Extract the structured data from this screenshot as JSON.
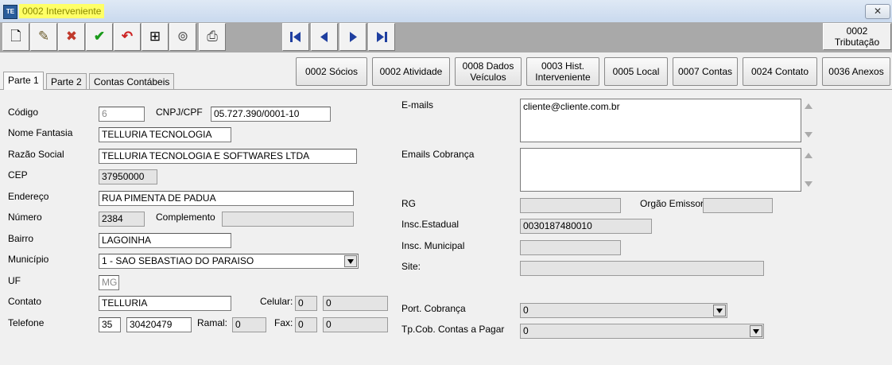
{
  "window": {
    "title": "0002 Interveniente",
    "app_icon": "TE",
    "close_symbol": "✕"
  },
  "toolbar": {
    "icons": [
      "new-document-icon",
      "edit-icon",
      "cancel-icon",
      "confirm-check-icon",
      "undo-icon",
      "binoculars-search-icon",
      "lookup-icon",
      "print-icon"
    ],
    "glyphs": {
      "new": "🗋",
      "edit": "✎",
      "cancel": "✖",
      "confirm": "✔",
      "undo": "↶",
      "search": "⊞",
      "lookup": "⊚",
      "print": "⎙"
    },
    "tributacao_line1": "0002",
    "tributacao_line2": "Tributação"
  },
  "actions": {
    "socios": "0002 Sócios",
    "atividade": "0002 Atividade",
    "dados_veiculos_1": "0008 Dados",
    "dados_veiculos_2": "Veículos",
    "hist_1": "0003 Hist.",
    "hist_2": "Interveniente",
    "local": "0005 Local",
    "contas": "0007 Contas",
    "contato": "0024 Contato",
    "anexos": "0036 Anexos"
  },
  "tabs": [
    "Parte 1",
    "Parte 2",
    "Contas Contábeis"
  ],
  "form_left": {
    "codigo_label": "Código",
    "codigo_value": "6",
    "cnpj_label": "CNPJ/CPF",
    "cnpj_value": "05.727.390/0001-10",
    "nome_fantasia_label": "Nome Fantasia",
    "nome_fantasia_value": "TELLURIA TECNOLOGIA",
    "razao_social_label": "Razão Social",
    "razao_social_value": "TELLURIA TECNOLOGIA E SOFTWARES LTDA",
    "cep_label": "CEP",
    "cep_value": "37950000",
    "endereco_label": "Endereço",
    "endereco_value": "RUA PIMENTA DE PADUA",
    "numero_label": "Número",
    "numero_value": "2384",
    "complemento_label": "Complemento",
    "complemento_value": "",
    "bairro_label": "Bairro",
    "bairro_value": "LAGOINHA",
    "municipio_label": "Município",
    "municipio_value": "1 - SAO SEBASTIAO DO PARAISO",
    "uf_label": "UF",
    "uf_value": "MG",
    "contato_label": "Contato",
    "contato_value": "TELLURIA",
    "celular_label": "Celular:",
    "celular_ddd": "0",
    "celular_num": "0",
    "telefone_label": "Telefone",
    "telefone_ddd": "35",
    "telefone_num": "30420479",
    "ramal_label": "Ramal:",
    "ramal_value": "0",
    "fax_label": "Fax:",
    "fax_ddd": "0",
    "fax_num": "0"
  },
  "form_right": {
    "emails_label": "E-mails",
    "emails_value": "cliente@cliente.com.br",
    "emails_cobranca_label": "Emails Cobrança",
    "emails_cobranca_value": "",
    "rg_label": "RG",
    "rg_value": "",
    "orgao_label": "Orgão Emissor",
    "orgao_value": "",
    "insc_estadual_label": "Insc.Estadual",
    "insc_estadual_value": "0030187480010",
    "insc_municipal_label": "Insc. Municipal",
    "insc_municipal_value": "",
    "site_label": "Site:",
    "site_value": "",
    "port_cobranca_label": "Port. Cobrança",
    "port_cobranca_value": "0",
    "tp_cob_label": "Tp.Cob. Contas a Pagar",
    "tp_cob_value": "0"
  },
  "colors": {
    "title_highlight": "#ffff66",
    "toolbar_bg": "#a9a9a9",
    "nav_arrow": "#1f3fa0",
    "confirm": "#1a9a1a",
    "undo": "#cc2222"
  }
}
